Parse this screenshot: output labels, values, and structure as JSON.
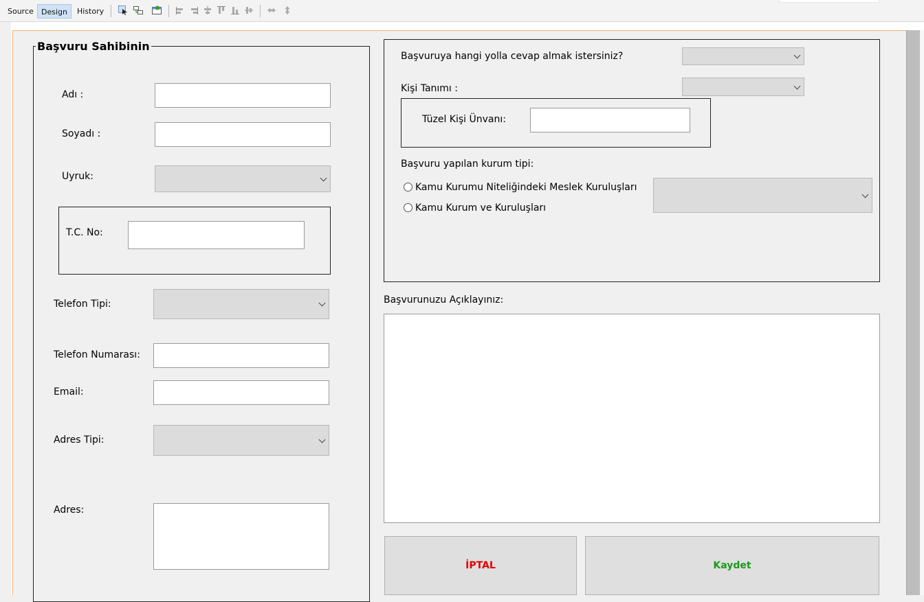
{
  "ide": {
    "tabs": [
      {
        "label": "Source",
        "active": false
      },
      {
        "label": "Design",
        "active": true
      },
      {
        "label": "History",
        "active": false
      }
    ],
    "tool_icons": [
      "selection-mode-icon",
      "connection-mode-icon",
      "preview-design-icon",
      "align-left-icon",
      "align-right-icon",
      "center-horizontally-icon",
      "align-top-icon",
      "align-bottom-icon",
      "center-vertically-icon",
      "horizontal-resize-icon",
      "vertical-resize-icon"
    ]
  },
  "applicant": {
    "title": "Başvuru Sahibinin",
    "name_label": "Adı :",
    "name_value": "",
    "surname_label": "Soyadı :",
    "surname_value": "",
    "nationality_label": "Uyruk:",
    "nationality_value": "",
    "tc_label": "T.C. No:",
    "tc_value": "",
    "phone_type_label": "Telefon Tipi:",
    "phone_type_value": "",
    "phone_number_label": "Telefon Numarası:",
    "phone_number_value": "",
    "email_label": "Email:",
    "email_value": "",
    "address_type_label": "Adres Tipi:",
    "address_type_value": "",
    "address_label": "Adres:",
    "address_value": ""
  },
  "request": {
    "response_method_label": "Başvuruya hangi yolla cevap almak istersiniz?",
    "response_method_value": "",
    "person_type_label": "Kişi Tanımı :",
    "person_type_value": "",
    "legal_title_label": "Tüzel Kişi Ünvanı:",
    "legal_title_value": "",
    "institution_type_label": "Başvuru yapılan kurum tipi:",
    "radio_options": [
      "Kamu Kurumu Niteliğindeki Meslek Kuruluşları",
      "Kamu Kurum ve Kuruluşları"
    ],
    "institution_value": "",
    "description_label": "Başvurunuzu Açıklayınız:",
    "description_value": ""
  },
  "actions": {
    "cancel_label": "İPTAL",
    "save_label": "Kaydet"
  },
  "colors": {
    "cancel_text": "#e00000",
    "save_text": "#1a9a1a",
    "canvas_border": "#f0b070",
    "active_tab": "#cfe2f5"
  }
}
